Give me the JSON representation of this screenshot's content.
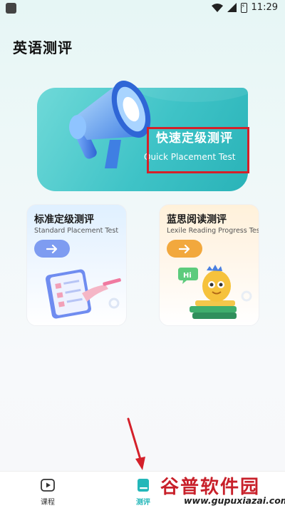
{
  "status_bar": {
    "time": "11:29"
  },
  "page_title": "英语测评",
  "quick_test": {
    "title": "快速定级测评",
    "subtitle": "Quick Placement Test"
  },
  "cards": [
    {
      "title": "标准定级测评",
      "subtitle": "Standard Placement Test",
      "accent": "#7e9cf1"
    },
    {
      "title": "蓝思阅读测评",
      "subtitle": "Lexile Reading Progress Test",
      "accent": "#f2a83d",
      "badge": "Hi"
    }
  ],
  "nav": {
    "items": [
      {
        "label": "课程",
        "icon": "play-icon",
        "active": false
      },
      {
        "label": "测评",
        "icon": "book-icon",
        "active": true
      }
    ]
  },
  "watermark": {
    "top": "谷普软件园",
    "bottom": "www.gupuxiazai.com"
  },
  "colors": {
    "brand": "#23b7b9",
    "highlight_box": "#d4202a"
  }
}
